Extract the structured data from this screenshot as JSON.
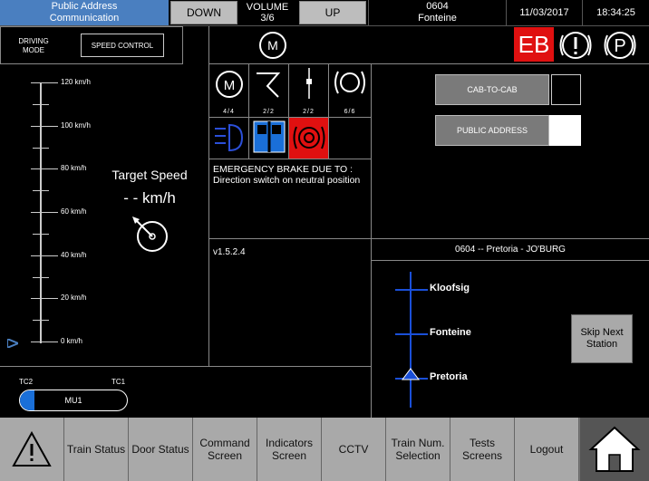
{
  "top": {
    "public_address_label": "Public Address Communication",
    "down_label": "DOWN",
    "volume_title": "VOLUME",
    "volume_value": "3/6",
    "up_label": "UP",
    "train_number": "0604",
    "station": "Fonteine",
    "date": "11/03/2017",
    "time": "18:34:25"
  },
  "mode": {
    "driving_mode_label": "DRIVING MODE",
    "speed_control_label": "SPEED CONTROL",
    "eb_label": "EB"
  },
  "speedo": {
    "ticks": [
      "120 km/h",
      "100 km/h",
      "80 km/h",
      "60 km/h",
      "40 km/h",
      "20 km/h",
      "0 km/h"
    ],
    "target_speed_label": "Target Speed",
    "target_speed_value": "- - km/h"
  },
  "indicators": {
    "motor_count": "4/4",
    "pantograph_count": "2/2",
    "switch_count": "2/2",
    "brake_count": "6/6"
  },
  "alert": {
    "message": "EMERGENCY BRAKE DUE TO : Direction switch on neutral position"
  },
  "version": "v1.5.2.4",
  "comm": {
    "cab_to_cab_label": "CAB-TO-CAB",
    "public_address_label": "PUBLIC ADDRESS"
  },
  "route": {
    "title": "0604 -- Pretoria - JO'BURG",
    "stations": [
      "Kloofsig",
      "Fonteine",
      "Pretoria"
    ],
    "skip_label": "Skip Next Station"
  },
  "consist": {
    "tc2": "TC2",
    "tc1": "TC1",
    "unit": "MU1"
  },
  "nav": {
    "train_status": "Train Status",
    "door_status": "Door Status",
    "command_screen": "Command Screen",
    "indicators_screen": "Indicators Screen",
    "cctv": "CCTV",
    "train_num_selection": "Train Num. Selection",
    "tests_screens": "Tests Screens",
    "logout": "Logout"
  },
  "colors": {
    "accent_blue": "#4a7fc0",
    "alarm_red": "#e01010",
    "nav_grey": "#a9a9a9"
  }
}
